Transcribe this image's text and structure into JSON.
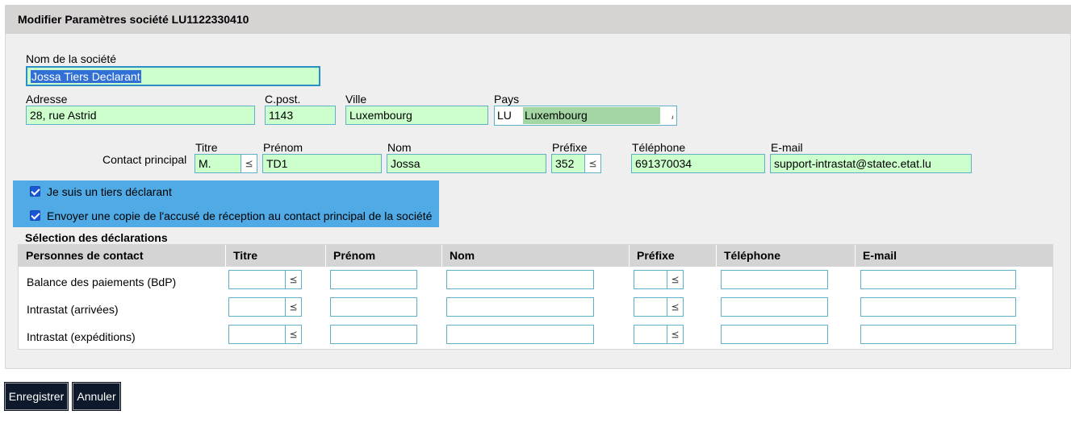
{
  "header": {
    "title": "Modifier Paramètres société LU1122330410"
  },
  "company": {
    "name_label": "Nom de la société",
    "name_value": "Jossa Tiers Declarant",
    "address_label": "Adresse",
    "address_value": "28, rue Astrid",
    "postcode_label": "C.post.",
    "postcode_value": "1143",
    "city_label": "Ville",
    "city_value": "Luxembourg",
    "country_label": "Pays",
    "country_code": "LU",
    "country_name": "Luxembourg"
  },
  "contact": {
    "section_label": "Contact principal",
    "title_label": "Titre",
    "title_value": "M.",
    "firstname_label": "Prénom",
    "firstname_value": "TD1",
    "lastname_label": "Nom",
    "lastname_value": "Jossa",
    "prefix_label": "Préfixe",
    "prefix_value": "352",
    "phone_label": "Téléphone",
    "phone_value": "691370034",
    "email_label": "E-mail",
    "email_value": "support-intrastat@statec.etat.lu"
  },
  "options": {
    "third_party_label": "Je suis un tiers déclarant",
    "third_party_checked": true,
    "copy_label": "Envoyer une copie de l'accusé de réception au contact principal de la société",
    "copy_checked": true
  },
  "declarations": {
    "section_title": "Sélection des déclarations",
    "columns": [
      "Personnes de contact",
      "Titre",
      "Prénom",
      "Nom",
      "Préfixe",
      "Téléphone",
      "E-mail"
    ],
    "rows": [
      {
        "label": "Balance des paiements (BdP)"
      },
      {
        "label": "Intrastat (arrivées)"
      },
      {
        "label": "Intrastat (expéditions)"
      }
    ]
  },
  "buttons": {
    "save": "Enregistrer",
    "cancel": "Annuler"
  },
  "icons": {
    "dropdown": "double-chevron-down-icon",
    "country_picker": "corner-arrow-icon"
  }
}
